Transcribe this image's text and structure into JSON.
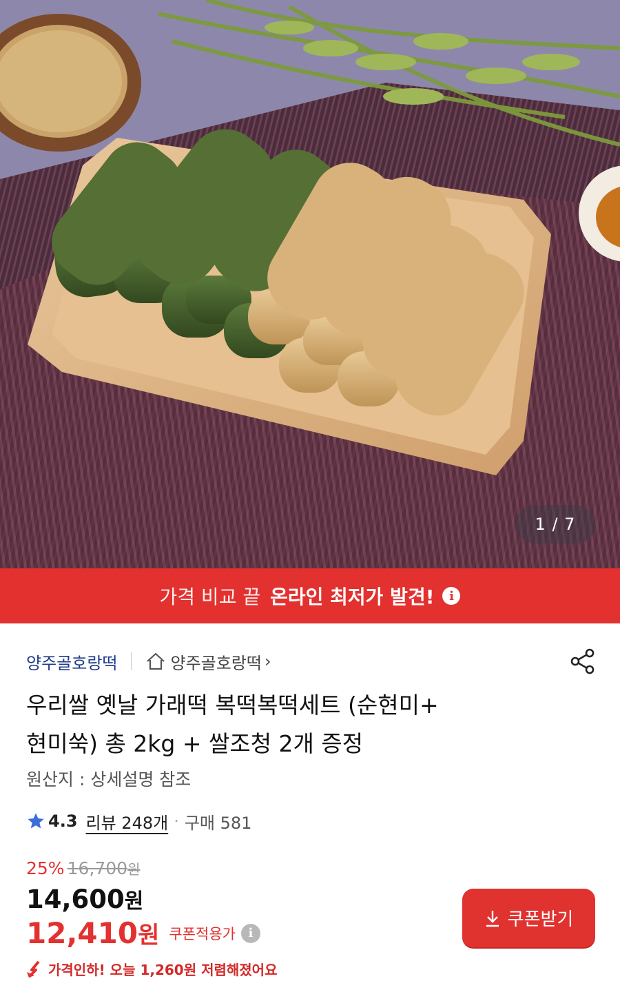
{
  "hero": {
    "image_desc_icon": "product-photo-rice-cakes",
    "counter": "1 / 7"
  },
  "promo": {
    "light_text": "가격 비교 끝",
    "bold_text": "온라인 최저가 발견!",
    "info_glyph": "i"
  },
  "seller": {
    "name": "양주골호랑떡",
    "store_link": "양주골호랑떡",
    "chevron": "›"
  },
  "product": {
    "title_line1": "우리쌀 옛날 가래떡 복떡복떡세트 (순현미+",
    "title_line2": "현미쑥) 총 2kg + 쌀조청 2개 증정",
    "origin": "원산지 : 상세설명 참조"
  },
  "rating": {
    "score": "4.3",
    "review": "리뷰 248개",
    "separator": "·",
    "purchases": "구매 581"
  },
  "price": {
    "discount": "25%",
    "original": "16,700",
    "original_unit": "원",
    "sale": "14,600",
    "sale_unit": "원",
    "coupon_price": "12,410",
    "coupon_unit": "원",
    "coupon_label": "쿠폰적용가",
    "coupon_info": "i",
    "drop_notice": "가격인하! 오늘 1,260원 저렴해졌어요"
  },
  "coupon_button": {
    "label": "쿠폰받기"
  },
  "colors": {
    "accent": "#e2312f",
    "seller": "#1e3a8a",
    "star": "#3b6fd8"
  }
}
